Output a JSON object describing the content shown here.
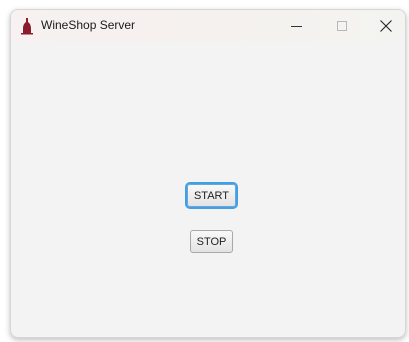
{
  "window": {
    "title": "WineShop Server",
    "icon": "wine-bottle-icon"
  },
  "titlebar_controls": {
    "minimize": "minimize-icon",
    "maximize": "maximize-icon",
    "close": "close-icon"
  },
  "buttons": {
    "start_label": "START",
    "stop_label": "STOP"
  },
  "colors": {
    "icon": "#8a1c2b",
    "focus_ring": "#3fa0e6"
  }
}
